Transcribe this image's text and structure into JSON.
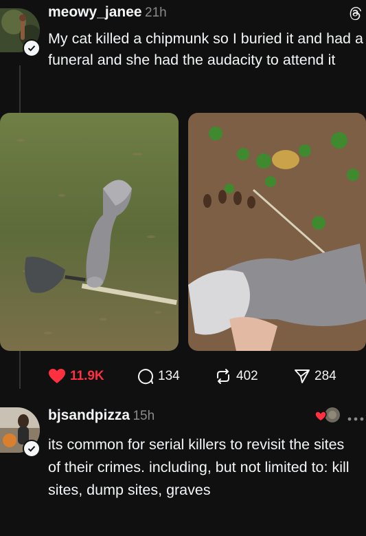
{
  "post": {
    "username": "meowy_janee",
    "time": "21h",
    "text": "My cat killed a chipmunk so I buried it and had a funeral and she had the audacity to attend it",
    "likes": "11.9K",
    "comments": "134",
    "reposts": "402",
    "shares": "284"
  },
  "reply": {
    "username": "bjsandpizza",
    "time": "15h",
    "text": "its common for serial killers to revisit the sites of their crimes. including, but not limited to: kill sites, dump sites, graves"
  },
  "colors": {
    "like": "#ff3040",
    "background": "#101010",
    "muted": "#8a8a8a"
  },
  "icons": [
    "threads-logo-icon",
    "heart-icon",
    "comment-icon",
    "repost-icon",
    "share-icon",
    "more-icon",
    "verified-icon"
  ]
}
